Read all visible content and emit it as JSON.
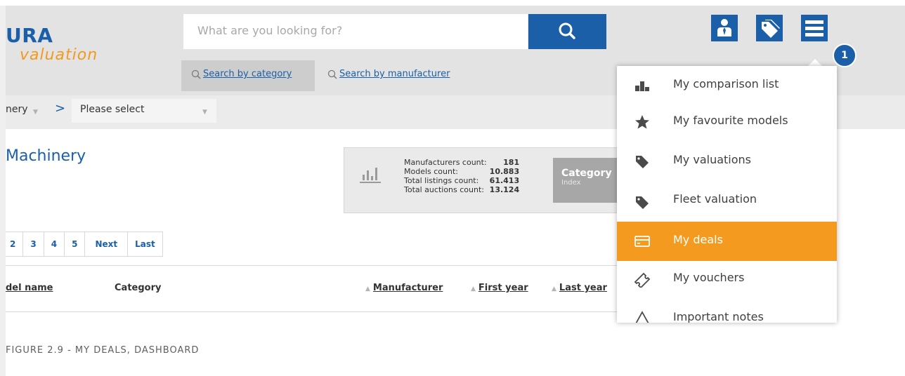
{
  "header": {
    "logo_top": "URA",
    "logo_bottom": "valuation",
    "search_placeholder": "What are you looking for?",
    "badge_number": "1"
  },
  "tabs": {
    "by_category": "Search by category",
    "by_manufacturer": "Search by manufacturer"
  },
  "breadcrumb": {
    "first_partial": "nery",
    "select_value": "Please select"
  },
  "main": {
    "title": "Machinery",
    "stats": [
      {
        "label": "Manufacturers count:",
        "value": "181"
      },
      {
        "label": "Models count:",
        "value": "10.883"
      },
      {
        "label": "Total listings count:",
        "value": "61.413"
      },
      {
        "label": "Total auctions count:",
        "value": "13.124"
      }
    ],
    "category_button_title": "Category",
    "category_button_sub": "Index"
  },
  "pagination": [
    "2",
    "3",
    "4",
    "5",
    "Next",
    "Last"
  ],
  "table_headers": {
    "model_name": "del name",
    "category": "Category",
    "manufacturer": "Manufacturer",
    "first_year": "First year",
    "last_year": "Last year"
  },
  "menu": {
    "items": [
      {
        "label": "My comparison list",
        "icon": "podium-icon"
      },
      {
        "label": "My favourite models",
        "icon": "star-icon"
      },
      {
        "label": "My valuations",
        "icon": "price-tag-icon"
      },
      {
        "label": "Fleet valuation",
        "icon": "price-tag-icon"
      },
      {
        "label": "My deals",
        "icon": "credit-card-icon",
        "active": true
      },
      {
        "label": "My vouchers",
        "icon": "ticket-icon"
      },
      {
        "label": "Important notes",
        "icon": "warning-icon"
      }
    ]
  },
  "caption": "FIGURE 2.9 - MY DEALS, DASHBOARD",
  "colors": {
    "brand_blue": "#1a5fa8",
    "accent_orange": "#f39a1f",
    "header_gray": "#e3e3e3"
  }
}
